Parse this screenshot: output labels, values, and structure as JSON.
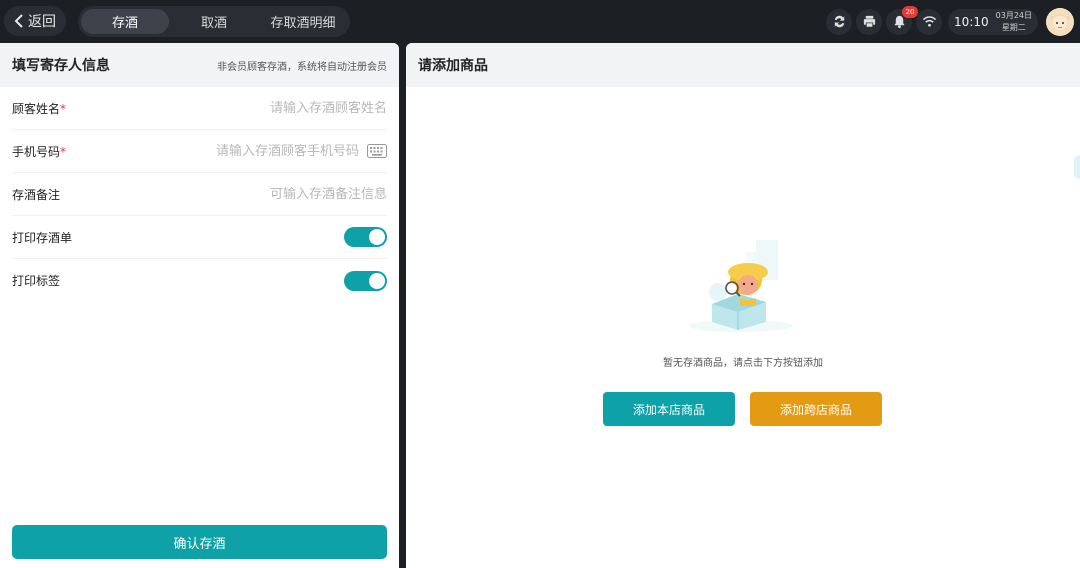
{
  "topbar": {
    "back_label": "返回",
    "tabs": [
      {
        "label": "存酒",
        "active": true
      },
      {
        "label": "取酒",
        "active": false
      },
      {
        "label": "存取酒明细",
        "active": false
      }
    ],
    "status": {
      "icons": [
        "sync-icon",
        "printer-icon",
        "bell-icon",
        "wifi-icon"
      ],
      "notification_count": "20",
      "time": "10:10",
      "date": "03月24日",
      "weekday": "星期二"
    }
  },
  "left_panel": {
    "title": "填写寄存人信息",
    "hint": "非会员顾客存酒，系统将自动注册会员",
    "fields": {
      "customer_name": {
        "label": "顾客姓名",
        "required_mark": "*",
        "placeholder": "请输入存酒顾客姓名",
        "value": ""
      },
      "phone": {
        "label": "手机号码",
        "required_mark": "*",
        "placeholder": "请输入存酒顾客手机号码",
        "value": ""
      },
      "remark": {
        "label": "存酒备注",
        "placeholder": "可输入存酒备注信息",
        "value": ""
      }
    },
    "toggles": {
      "print_receipt": {
        "label": "打印存酒单",
        "on": true
      },
      "print_label": {
        "label": "打印标签",
        "on": true
      }
    },
    "confirm_label": "确认存酒"
  },
  "right_panel": {
    "title": "请添加商品",
    "empty_text": "暂无存酒商品，请点击下方按钮添加",
    "add_local_label": "添加本店商品",
    "add_cross_label": "添加跨店商品"
  },
  "colors": {
    "accent": "#0ea2a8",
    "secondary": "#e39b14",
    "topbar_bg": "#1c1f24",
    "badge": "#e53935"
  }
}
